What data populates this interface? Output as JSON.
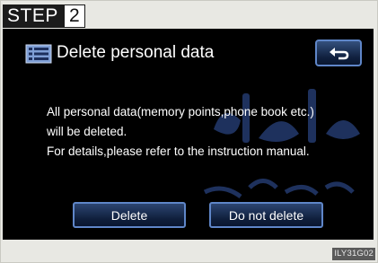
{
  "step": {
    "word": "STEP",
    "number": "2"
  },
  "dialog": {
    "icon": "document-list-icon",
    "title": "Delete personal data",
    "back_icon": "return-arrow-icon",
    "message_lines": [
      "All personal data(memory points,phone book etc.)",
      "will be deleted.",
      "For details,please refer to the instruction manual."
    ],
    "buttons": {
      "delete": "Delete",
      "do_not_delete": "Do not delete"
    }
  },
  "watermark": {
    "line1": "رو فارما",
    "line2": "۰۲۱-۸۸۸۶۲"
  },
  "image_code": "ILY31G02"
}
